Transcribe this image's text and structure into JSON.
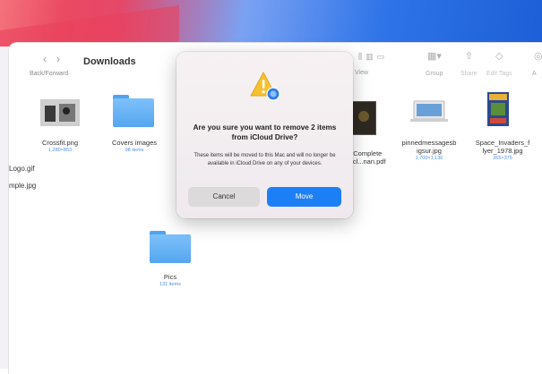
{
  "toolbar": {
    "nav_label": "Back/Forward",
    "title": "Downloads",
    "view_label": "View",
    "group_label": "Group",
    "share_label": "Share",
    "edit_tags_label": "Edit Tags",
    "more_label": "A"
  },
  "files": [
    {
      "name": "Crossfit.png",
      "meta": "1,280×853"
    },
    {
      "name": "Covers images",
      "meta": "98 items"
    },
    {
      "name_line1": "e Complete",
      "name_line2": "nicl...nan.pdf"
    },
    {
      "name_line1": "pinnedmessagesb",
      "name_line2": "igsur.jpg",
      "meta": "1,700×1,130"
    },
    {
      "name_line1": "Space_Invaders_f",
      "name_line2": "lyer_1978.jpg",
      "meta": "265×375"
    },
    {
      "name": "Pics",
      "meta": "131 items"
    }
  ],
  "side_items": {
    "logo": "Logo.gif",
    "sample": "mple.jpg"
  },
  "dialog": {
    "title": "Are you sure you want to remove 2 items from iCloud Drive?",
    "message": "These items will be moved to this Mac and will no longer be available in iCloud Drive on any of your devices.",
    "cancel_label": "Cancel",
    "move_label": "Move"
  },
  "colors": {
    "accent": "#1d7ff6",
    "folder": "#5aaaf0",
    "meta": "#4d8fe9"
  }
}
